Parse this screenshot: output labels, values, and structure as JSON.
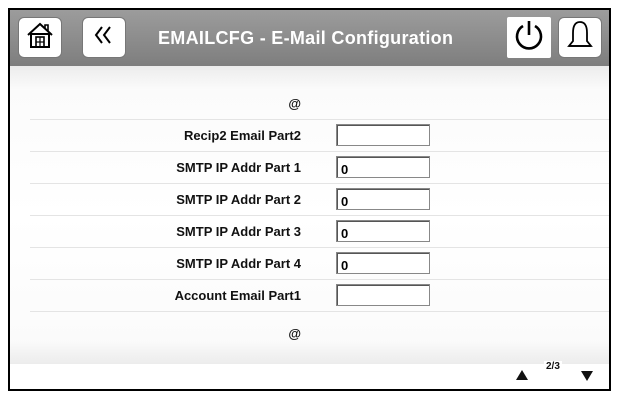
{
  "header": {
    "title": "EMAILCFG - E-Mail Configuration",
    "home_icon": "home-icon",
    "back_icon": "back-chevrons-icon",
    "power_icon": "power-icon",
    "alarm_icon": "bell-icon"
  },
  "rows": [
    {
      "label": "@",
      "value": null
    },
    {
      "label": "Recip2 Email Part2",
      "value": ""
    },
    {
      "label": "SMTP IP Addr Part 1",
      "value": "0"
    },
    {
      "label": "SMTP IP Addr Part 2",
      "value": "0"
    },
    {
      "label": "SMTP IP Addr Part 3",
      "value": "0"
    },
    {
      "label": "SMTP IP Addr Part 4",
      "value": "0"
    },
    {
      "label": "Account Email Part1",
      "value": ""
    },
    {
      "label": "@",
      "value": null
    }
  ],
  "footer": {
    "page_indicator": "2/3",
    "up_icon": "triangle-up-icon",
    "down_icon": "triangle-down-icon"
  }
}
